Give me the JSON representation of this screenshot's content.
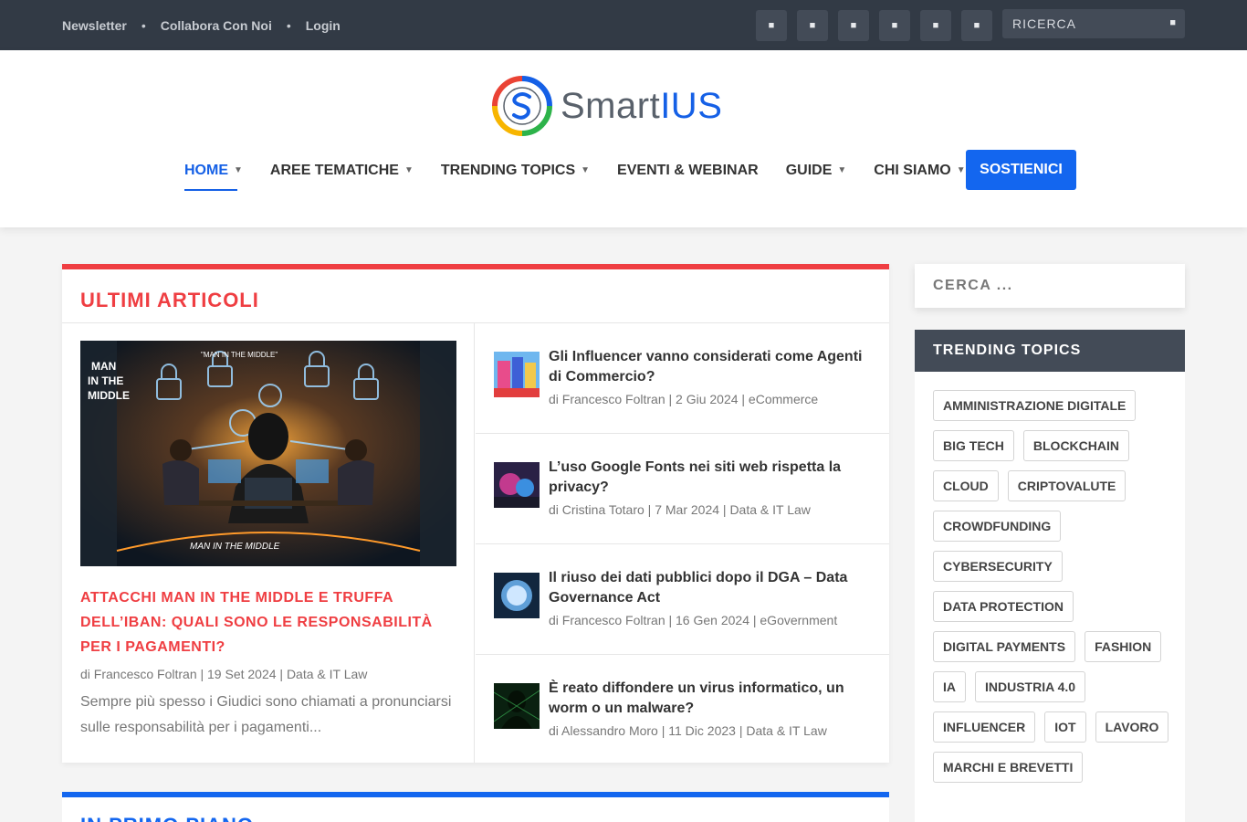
{
  "topbar": {
    "links": [
      "Newsletter",
      "Collabora Con Noi",
      "Login"
    ],
    "separator": "•",
    "socials": [
      "facebook-icon",
      "twitter-icon",
      "linkedin-icon",
      "instagram-icon",
      "youtube-icon",
      "rss-icon"
    ],
    "search_placeholder": "RICERCA"
  },
  "brand": {
    "name_part1": "Smart",
    "name_part2": "IUS"
  },
  "nav": {
    "items": [
      {
        "label": "HOME",
        "caret": true
      },
      {
        "label": "AREE TEMATICHE",
        "caret": true
      },
      {
        "label": "TRENDING TOPICS",
        "caret": true
      },
      {
        "label": "EVENTI & WEBINAR",
        "caret": false
      },
      {
        "label": "GUIDE",
        "caret": true
      },
      {
        "label": "CHI SIAMO",
        "caret": true
      }
    ],
    "cta": "SOSTIENICI"
  },
  "latest": {
    "title": "ULTIMI ARTICOLI",
    "featured": {
      "title": "ATTACCHI MAN IN THE MIDDLE E TRUFFA DELL’IBAN: QUALI SONO LE RESPONSABILITÀ PER I PAGAMENTI?",
      "meta": "di Francesco Foltran | 19 Set 2024 | Data & IT Law",
      "excerpt": "Sempre più spesso i Giudici sono chiamati a pronunciarsi sulle responsabilità per i pagamenti...",
      "image_text": [
        "MAN",
        "IN THE",
        "MIDDLE",
        "\"MAN IN THE MIDDLE\"",
        "MAN IN THE MIDDLE"
      ]
    },
    "posts": [
      {
        "title": "Gli Influencer vanno considerati come Agenti di Commercio?",
        "meta": "di Francesco Foltran | 2 Giu 2024 | eCommerce"
      },
      {
        "title": "L’uso Google Fonts nei siti web rispetta la privacy?",
        "meta": "di Cristina Totaro | 7 Mar 2024 | Data & IT Law"
      },
      {
        "title": "Il riuso dei dati pubblici dopo il DGA – Data Governance Act",
        "meta": "di Francesco Foltran | 16 Gen 2024 | eGovernment"
      },
      {
        "title": "È reato diffondere un virus informatico, un worm o un malware?",
        "meta": "di Alessandro Moro | 11 Dic 2023 | Data & IT Law"
      }
    ]
  },
  "second_section": {
    "title": "IN PRIMO PIANO"
  },
  "sidebar": {
    "search_placeholder": "CERCA ...",
    "trending_title": "TRENDING TOPICS",
    "tags": [
      "AMMINISTRAZIONE DIGITALE",
      "BIG TECH",
      "BLOCKCHAIN",
      "CLOUD",
      "CRIPTOVALUTE",
      "CROWDFUNDING",
      "CYBERSECURITY",
      "DATA PROTECTION",
      "DIGITAL PAYMENTS",
      "FASHION",
      "IA",
      "INDUSTRIA 4.0",
      "INFLUENCER",
      "IOT",
      "LAVORO",
      "MARCHI E BREVETTI"
    ]
  },
  "colors": {
    "accent_red": "#ef3e42",
    "accent_blue": "#1366ef",
    "topbar": "#323a45"
  }
}
